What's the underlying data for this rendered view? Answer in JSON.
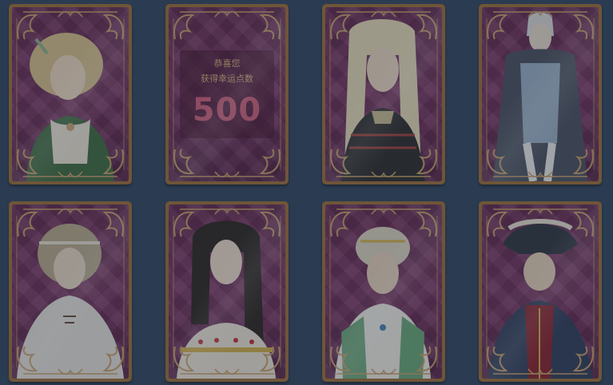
{
  "reward": {
    "line1": "恭喜您",
    "line2": "获得幸运点数",
    "amount": "500"
  },
  "cards": [
    {
      "kind": "portrait",
      "character": "blonde-noble-green-dress"
    },
    {
      "kind": "reward"
    },
    {
      "kind": "portrait",
      "character": "long-haired-braided-man"
    },
    {
      "kind": "portrait",
      "character": "caped-nobleman"
    },
    {
      "kind": "portrait",
      "character": "headband-youth-cloak"
    },
    {
      "kind": "portrait",
      "character": "long-haired-lady"
    },
    {
      "kind": "portrait",
      "character": "turbaned-man-green-vest"
    },
    {
      "kind": "portrait",
      "character": "tricorn-captain"
    }
  ],
  "colors": {
    "background": "#2b3c52",
    "card_border": "#6f5538",
    "card_face": "#7a3162",
    "ornament": "#c9a06a",
    "reward_text": "#d9b27c",
    "reward_number": "#cf5d79"
  }
}
